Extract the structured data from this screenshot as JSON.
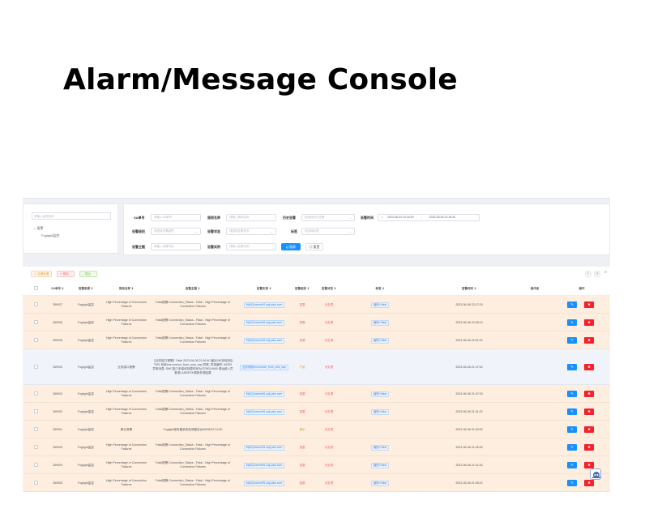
{
  "slide": {
    "title": "Alarm/Message Console"
  },
  "tree": {
    "search_placeholder": "请输入监测名称",
    "root_label": "报警",
    "child_label": "Foglight监控"
  },
  "filters": {
    "sa_label": "SA单号",
    "sa_placeholder": "请输入SA单号",
    "rule_label": "规则名称",
    "rule_placeholder": "请输入规则名称",
    "history_label": "历史告警",
    "history_placeholder": "请选择历史告警",
    "time_label": "告警时间",
    "time_start": "2023-06-04 22:16:20",
    "time_sep": "-",
    "time_end": "2023-06-06 22:16:20",
    "level_label": "告警级别",
    "level_placeholder": "请选择告警级别",
    "status_label": "告警状态",
    "status_placeholder": "请选择告警状态",
    "tag_label": "标签",
    "tag_placeholder": "请选择标签",
    "subject_label": "告警主题",
    "subject_placeholder": "请输入告警内容",
    "instance_label": "告警实例",
    "instance_placeholder": "请输入告警实例",
    "search_button": "Q 搜索",
    "reset_button": "◎ 重置"
  },
  "toolbar": {
    "confirm_label": "☆ 告警处置",
    "delete_label": "✕ 删除",
    "export_label": "↓ 导出"
  },
  "table": {
    "headers": {
      "sa": "SA单号 ⇕",
      "source": "告警来源 ⇕",
      "rule": "规则名称 ⇕",
      "subject": "告警主题 ⇕",
      "instance": "告警实例 ⇕",
      "level": "告警级别 ⇕",
      "status": "告警状态 ⇕",
      "tag": "标签 ⇕",
      "time": "告警时间 ⇕",
      "operator": "操作者",
      "action": "操作"
    },
    "action_buttons": {
      "edit": "✎",
      "del": "✖"
    },
    "rows": [
      {
        "sa": "359937",
        "source": "Foglight监控",
        "rule": "High Percentage of Connection Failures",
        "subject": "Fatal报警:Connection_Status - Fatal - High Percentage of Connection Failures",
        "instance": "MySQLserver91.aoji-plus.com",
        "level": "重要",
        "status": "未处理",
        "tag": "级别=Fatal",
        "time": "2023-06-06 22:17:15",
        "style": "orange"
      },
      {
        "sa": "359936",
        "source": "Foglight监控",
        "rule": "High Percentage of Connection Failures",
        "subject": "Fatal报警:Connection_Status - Fatal - High Percentage of Connection Failures",
        "instance": "MySQLserver91.aoji-plus.com",
        "level": "重要",
        "status": "未处理",
        "tag": "级别=Fatal",
        "time": "2023-06-06 22:06:19",
        "style": "orange"
      },
      {
        "sa": "359935",
        "source": "Foglight监控",
        "rule": "High Percentage of Connection Failures",
        "subject": "Fatal报警:Connection_Status - Fatal - High Percentage of Connection Failures",
        "instance": "MySQLserver91.aoji-plus.com",
        "level": "重要",
        "status": "未处理",
        "tag": "级别=Fatal",
        "time": "2023-06-06 22:01:24",
        "style": "orange"
      },
      {
        "sa": "359934",
        "source": "Foglight监控",
        "rule": "业务接口报警",
        "subject": "【业务接口报警】Fatal 2023-06-06 21:46:40 最近5分钟检测出TMS 系统tms.receive_from_sms_sap 异常, 异常编号: 54253 异常消息: SMC接口未接收到源时间为2239014645 请运维人员登录LANDESK更新处理结果",
        "instance": "业务系统tms.receive_from_sms_sap",
        "level": "严重",
        "status": "未处理",
        "tag": "",
        "time": "2023-06-06 21:47:00",
        "style": "blue"
      },
      {
        "sa": "359933",
        "source": "Foglight监控",
        "rule": "High Percentage of Connection Failures",
        "subject": "Fatal报警:Connection_Status - Fatal - High Percentage of Connection Failures",
        "instance": "MySQLserver91.aoji-plus.com",
        "level": "重要",
        "status": "未处理",
        "tag": "级别=Fatal",
        "time": "2023-06-06 21:47:29",
        "style": "orange"
      },
      {
        "sa": "359932",
        "source": "Foglight监控",
        "rule": "High Percentage of Connection Failures",
        "subject": "Fatal报警:Connection_Status - Fatal - High Percentage of Connection Failures",
        "instance": "MySQLserver91.aoji-plus.com",
        "level": "重要",
        "status": "未处理",
        "tag": "级别=Fatal",
        "time": "2023-06-06 21:41:22",
        "style": "orange"
      },
      {
        "sa": "359931",
        "source": "Foglight监控",
        "rule": "默认报警",
        "subject": "Foglight服务器状态检测报告@06/06/23 21:30",
        "instance": "",
        "level": "提示",
        "status": "未处理",
        "tag": "",
        "time": "2023-06-06 21:30:00",
        "style": "orange"
      },
      {
        "sa": "359930",
        "source": "Foglight监控",
        "rule": "High Percentage of Connection Failures",
        "subject": "Fatal报警:Connection_Status - Fatal - High Percentage of Connection Failures",
        "instance": "MySQLserver91.aoji-plus.com",
        "level": "重要",
        "status": "未处理",
        "tag": "级别=Fatal",
        "time": "2023-06-06 21:26:26",
        "style": "orange"
      },
      {
        "sa": "359929",
        "source": "Foglight监控",
        "rule": "High Percentage of Connection Failures",
        "subject": "Fatal报警:Connection_Status - Fatal - High Percentage of Connection Failures",
        "instance": "MySQLserver91.aoji-plus.com",
        "level": "重要",
        "status": "未处理",
        "tag": "级别=Fatal",
        "time": "2023-06-06 21:11:18",
        "style": "orange"
      },
      {
        "sa": "359928",
        "source": "Foglight监控",
        "rule": "High Percentage of Connection Failures",
        "subject": "Fatal报警:Connection_Status - Fatal - High Percentage of Connection Failures",
        "instance": "MySQLserver91.aoji-plus.com",
        "level": "重要",
        "status": "未处理",
        "tag": "级别=Fatal",
        "time": "2023-06-06 21:05:22",
        "style": "orange"
      }
    ]
  },
  "colors": {
    "primary": "#1890ff",
    "danger": "#f5222d",
    "row_highlight": "#fdeee0",
    "row_alt": "#f1f3fa",
    "level_important": "#f56c6c",
    "level_severe": "#e6a23c",
    "level_hint": "#c9a227"
  }
}
